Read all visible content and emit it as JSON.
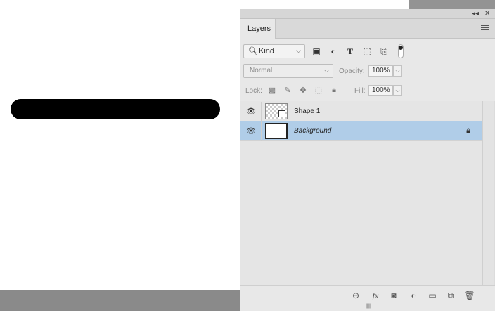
{
  "panel": {
    "tab_label": "Layers",
    "topbar": {
      "collapse_glyph": "◂◂",
      "close_glyph": "✕"
    }
  },
  "filter": {
    "kind_icon": "search-icon",
    "kind_label": "Kind",
    "icons": [
      "image-filter-icon",
      "adjustment-filter-icon",
      "type-filter-icon",
      "shape-filter-icon",
      "smart-object-filter-icon"
    ]
  },
  "blend": {
    "mode": "Normal",
    "opacity_label": "Opacity:",
    "opacity_value": "100%"
  },
  "lock": {
    "label": "Lock:",
    "fill_label": "Fill:",
    "fill_value": "100%"
  },
  "layers": [
    {
      "name": "Shape 1",
      "visible": true,
      "selected": false
    },
    {
      "name": "Background",
      "visible": true,
      "selected": true,
      "locked": true
    }
  ],
  "bottombar": {
    "icons": [
      "link-layers-icon",
      "fx-icon",
      "add-mask-icon",
      "adjustment-layer-icon",
      "new-group-icon",
      "new-layer-icon",
      "delete-layer-icon"
    ],
    "fx_label": "fx"
  }
}
